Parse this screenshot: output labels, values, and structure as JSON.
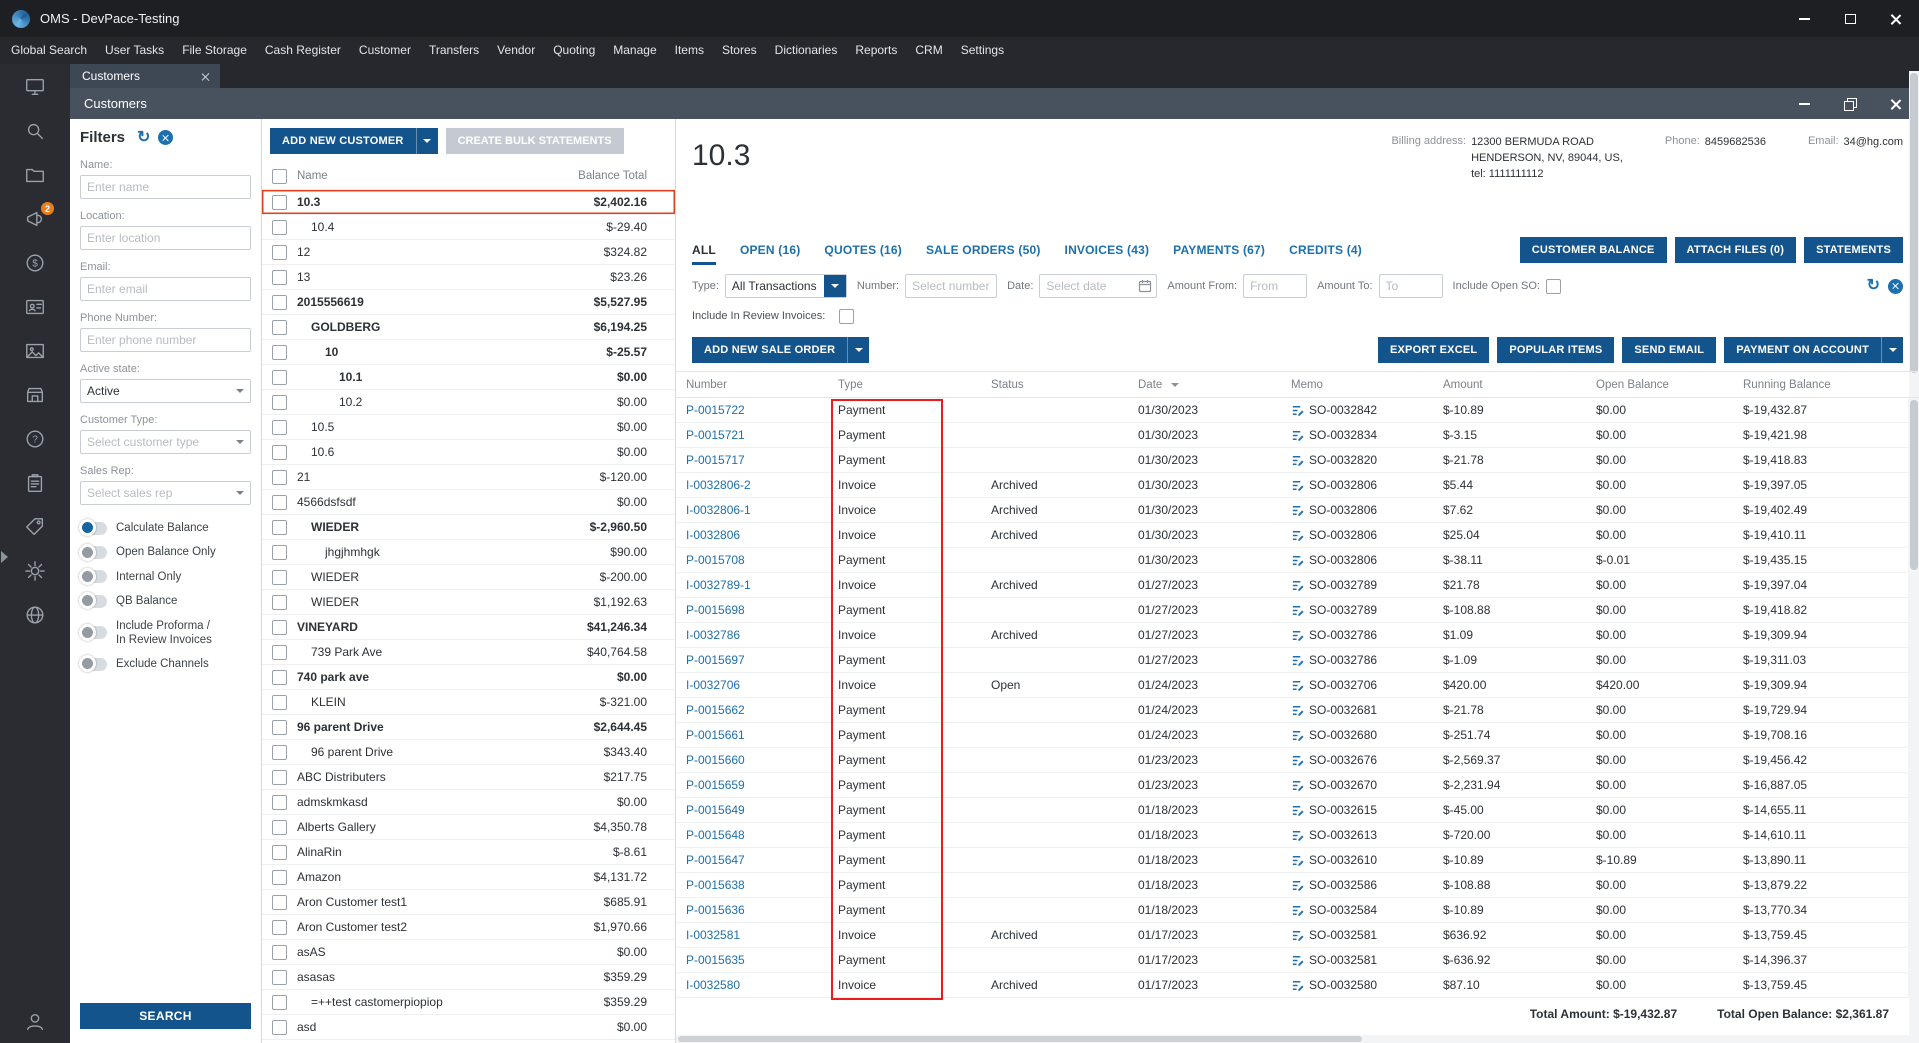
{
  "titlebar": {
    "title": "OMS - DevPace-Testing"
  },
  "menubar": {
    "items": [
      "Global Search",
      "User Tasks",
      "File Storage",
      "Cash Register",
      "Customer",
      "Transfers",
      "Vendor",
      "Quoting",
      "Manage",
      "Items",
      "Stores",
      "Dictionaries",
      "Reports",
      "CRM",
      "Settings"
    ]
  },
  "doc_tab": {
    "label": "Customers"
  },
  "inner_window": {
    "title": "Customers"
  },
  "icons": {
    "refresh": "↻"
  },
  "colors": {
    "accent_blue": "#14548c",
    "link_blue": "#1d6fad",
    "annotation_red": "#ec1c1c",
    "selected_row_orange": "#e2411e",
    "badge_orange": "#e87f1e"
  },
  "sidebar": {
    "badge": "2",
    "icon_names": [
      "dashboard-icon",
      "search-icon",
      "folder-icon",
      "announcements-icon",
      "payments-icon",
      "contacts-icon",
      "media-icon",
      "store-icon",
      "help-icon",
      "clipboard-icon",
      "tag-icon",
      "gear-icon",
      "globe-icon",
      "user-icon"
    ]
  },
  "filters": {
    "title": "Filters",
    "name_label": "Name:",
    "name_placeholder": "Enter name",
    "location_label": "Location:",
    "location_placeholder": "Enter location",
    "email_label": "Email:",
    "email_placeholder": "Enter email",
    "phone_label": "Phone Number:",
    "phone_placeholder": "Enter phone number",
    "active_state_label": "Active state:",
    "active_state_value": "Active",
    "customer_type_label": "Customer Type:",
    "customer_type_placeholder": "Select customer type",
    "sales_rep_label": "Sales Rep:",
    "sales_rep_placeholder": "Select sales rep",
    "toggles": [
      {
        "label": "Calculate Balance",
        "cls": "on"
      },
      {
        "label": "Open Balance Only",
        "cls": ""
      },
      {
        "label": "Internal Only",
        "cls": ""
      },
      {
        "label": "QB Balance",
        "cls": ""
      },
      {
        "label": "Include Proforma /\nIn Review Invoices",
        "cls": ""
      },
      {
        "label": "Exclude Channels",
        "cls": ""
      }
    ],
    "search_button": "SEARCH"
  },
  "customer_list": {
    "add_button": "ADD NEW CUSTOMER",
    "bulk_button": "CREATE BULK STATEMENTS",
    "columns": {
      "name": "Name",
      "balance": "Balance Total"
    },
    "rows": [
      {
        "name": "10.3",
        "balance": "$2,402.16",
        "cls": "bold selected"
      },
      {
        "name": "10.4",
        "balance": "$-29.40",
        "cls": "i1"
      },
      {
        "name": "12",
        "balance": "$324.82",
        "cls": ""
      },
      {
        "name": "13",
        "balance": "$23.26",
        "cls": ""
      },
      {
        "name": "2015556619",
        "balance": "$5,527.95",
        "cls": "bold"
      },
      {
        "name": "GOLDBERG",
        "balance": "$6,194.25",
        "cls": "bold i1"
      },
      {
        "name": "10",
        "balance": "$-25.57",
        "cls": "bold i2"
      },
      {
        "name": "10.1",
        "balance": "$0.00",
        "cls": "bold i3"
      },
      {
        "name": "10.2",
        "balance": "$0.00",
        "cls": "i3"
      },
      {
        "name": "10.5",
        "balance": "$0.00",
        "cls": "i1"
      },
      {
        "name": "10.6",
        "balance": "$0.00",
        "cls": "i1"
      },
      {
        "name": "21",
        "balance": "$-120.00",
        "cls": ""
      },
      {
        "name": "4566dsfsdf",
        "balance": "$0.00",
        "cls": ""
      },
      {
        "name": "WIEDER",
        "balance": "$-2,960.50",
        "cls": "bold i1"
      },
      {
        "name": "jhgjhmhgk",
        "balance": "$90.00",
        "cls": "i2"
      },
      {
        "name": "WIEDER",
        "balance": "$-200.00",
        "cls": "i1"
      },
      {
        "name": "WIEDER",
        "balance": "$1,192.63",
        "cls": "i1"
      },
      {
        "name": "VINEYARD",
        "balance": "$41,246.34",
        "cls": "bold"
      },
      {
        "name": "739 Park Ave",
        "balance": "$40,764.58",
        "cls": "i1"
      },
      {
        "name": "740 park ave",
        "balance": "$0.00",
        "cls": "bold"
      },
      {
        "name": "KLEIN",
        "balance": "$-321.00",
        "cls": "i1"
      },
      {
        "name": "96 parent Drive",
        "balance": "$2,644.45",
        "cls": "bold"
      },
      {
        "name": "96 parent Drive",
        "balance": "$343.40",
        "cls": "i1"
      },
      {
        "name": "ABC Distributers",
        "balance": "$217.75",
        "cls": ""
      },
      {
        "name": "admskmkasd",
        "balance": "$0.00",
        "cls": ""
      },
      {
        "name": "Alberts Gallery",
        "balance": "$4,350.78",
        "cls": ""
      },
      {
        "name": "AlinaRin",
        "balance": "$-8.61",
        "cls": ""
      },
      {
        "name": "Amazon",
        "balance": "$4,131.72",
        "cls": ""
      },
      {
        "name": "Aron Customer test1",
        "balance": "$685.91",
        "cls": ""
      },
      {
        "name": "Aron Customer test2",
        "balance": "$1,970.66",
        "cls": ""
      },
      {
        "name": "asAS",
        "balance": "$0.00",
        "cls": ""
      },
      {
        "name": "asasas",
        "balance": "$359.29",
        "cls": ""
      },
      {
        "name": "=++test castomerpiopiop",
        "balance": "$359.29",
        "cls": "i1"
      },
      {
        "name": "asd",
        "balance": "$0.00",
        "cls": ""
      }
    ]
  },
  "detail": {
    "customer_name": "10.3",
    "billing": {
      "address_label": "Billing address:",
      "address": "12300 BERMUDA ROAD\nHENDERSON, NV, 89044, US,\ntel: 1111111112",
      "phone_label": "Phone:",
      "phone": "8459682536",
      "email_label": "Email:",
      "email": "34@hg.com"
    },
    "tabs": [
      {
        "label": "ALL",
        "cls": "active"
      },
      {
        "label": "OPEN (16)",
        "cls": ""
      },
      {
        "label": "QUOTES (16)",
        "cls": ""
      },
      {
        "label": "SALE ORDERS (50)",
        "cls": ""
      },
      {
        "label": "INVOICES (43)",
        "cls": ""
      },
      {
        "label": "PAYMENTS (67)",
        "cls": ""
      },
      {
        "label": "CREDITS (4)",
        "cls": ""
      }
    ],
    "header_buttons": {
      "customer_balance": "CUSTOMER BALANCE",
      "attach_files": "ATTACH FILES (0)",
      "statements": "STATEMENTS"
    },
    "filter_bar": {
      "type_label": "Type:",
      "type_value": "All Transactions",
      "number_label": "Number:",
      "number_placeholder": "Select number",
      "date_label": "Date:",
      "date_placeholder": "Select date",
      "amount_from_label": "Amount From:",
      "amount_from_placeholder": "From",
      "amount_to_label": "Amount To:",
      "amount_to_placeholder": "To",
      "include_open_so_label": "Include Open SO:",
      "include_review_label": "Include In Review Invoices:"
    },
    "toolbar": {
      "add_sale_order": "ADD NEW SALE ORDER",
      "export_excel": "EXPORT EXCEL",
      "popular_items": "POPULAR ITEMS",
      "send_email": "SEND EMAIL",
      "payment_on_account": "PAYMENT ON ACCOUNT"
    },
    "grid": {
      "columns": [
        "Number",
        "Type",
        "Status",
        "Date",
        "Memo",
        "Amount",
        "Open Balance",
        "Running Balance"
      ],
      "rows": [
        {
          "number": "P-0015722",
          "type": "Payment",
          "status": "",
          "date": "01/30/2023",
          "memo": "SO-0032842",
          "amount": "$-10.89",
          "open": "$0.00",
          "running": "$-19,432.87"
        },
        {
          "number": "P-0015721",
          "type": "Payment",
          "status": "",
          "date": "01/30/2023",
          "memo": "SO-0032834",
          "amount": "$-3.15",
          "open": "$0.00",
          "running": "$-19,421.98"
        },
        {
          "number": "P-0015717",
          "type": "Payment",
          "status": "",
          "date": "01/30/2023",
          "memo": "SO-0032820",
          "amount": "$-21.78",
          "open": "$0.00",
          "running": "$-19,418.83"
        },
        {
          "number": "I-0032806-2",
          "type": "Invoice",
          "status": "Archived",
          "date": "01/30/2023",
          "memo": "SO-0032806",
          "amount": "$5.44",
          "open": "$0.00",
          "running": "$-19,397.05"
        },
        {
          "number": "I-0032806-1",
          "type": "Invoice",
          "status": "Archived",
          "date": "01/30/2023",
          "memo": "SO-0032806",
          "amount": "$7.62",
          "open": "$0.00",
          "running": "$-19,402.49"
        },
        {
          "number": "I-0032806",
          "type": "Invoice",
          "status": "Archived",
          "date": "01/30/2023",
          "memo": "SO-0032806",
          "amount": "$25.04",
          "open": "$0.00",
          "running": "$-19,410.11"
        },
        {
          "number": "P-0015708",
          "type": "Payment",
          "status": "",
          "date": "01/30/2023",
          "memo": "SO-0032806",
          "amount": "$-38.11",
          "open": "$-0.01",
          "running": "$-19,435.15"
        },
        {
          "number": "I-0032789-1",
          "type": "Invoice",
          "status": "Archived",
          "date": "01/27/2023",
          "memo": "SO-0032789",
          "amount": "$21.78",
          "open": "$0.00",
          "running": "$-19,397.04"
        },
        {
          "number": "P-0015698",
          "type": "Payment",
          "status": "",
          "date": "01/27/2023",
          "memo": "SO-0032789",
          "amount": "$-108.88",
          "open": "$0.00",
          "running": "$-19,418.82"
        },
        {
          "number": "I-0032786",
          "type": "Invoice",
          "status": "Archived",
          "date": "01/27/2023",
          "memo": "SO-0032786",
          "amount": "$1.09",
          "open": "$0.00",
          "running": "$-19,309.94"
        },
        {
          "number": "P-0015697",
          "type": "Payment",
          "status": "",
          "date": "01/27/2023",
          "memo": "SO-0032786",
          "amount": "$-1.09",
          "open": "$0.00",
          "running": "$-19,311.03"
        },
        {
          "number": "I-0032706",
          "type": "Invoice",
          "status": "Open",
          "date": "01/24/2023",
          "memo": "SO-0032706",
          "amount": "$420.00",
          "open": "$420.00",
          "running": "$-19,309.94"
        },
        {
          "number": "P-0015662",
          "type": "Payment",
          "status": "",
          "date": "01/24/2023",
          "memo": "SO-0032681",
          "amount": "$-21.78",
          "open": "$0.00",
          "running": "$-19,729.94"
        },
        {
          "number": "P-0015661",
          "type": "Payment",
          "status": "",
          "date": "01/24/2023",
          "memo": "SO-0032680",
          "amount": "$-251.74",
          "open": "$0.00",
          "running": "$-19,708.16"
        },
        {
          "number": "P-0015660",
          "type": "Payment",
          "status": "",
          "date": "01/23/2023",
          "memo": "SO-0032676",
          "amount": "$-2,569.37",
          "open": "$0.00",
          "running": "$-19,456.42"
        },
        {
          "number": "P-0015659",
          "type": "Payment",
          "status": "",
          "date": "01/23/2023",
          "memo": "SO-0032670",
          "amount": "$-2,231.94",
          "open": "$0.00",
          "running": "$-16,887.05"
        },
        {
          "number": "P-0015649",
          "type": "Payment",
          "status": "",
          "date": "01/18/2023",
          "memo": "SO-0032615",
          "amount": "$-45.00",
          "open": "$0.00",
          "running": "$-14,655.11"
        },
        {
          "number": "P-0015648",
          "type": "Payment",
          "status": "",
          "date": "01/18/2023",
          "memo": "SO-0032613",
          "amount": "$-720.00",
          "open": "$0.00",
          "running": "$-14,610.11"
        },
        {
          "number": "P-0015647",
          "type": "Payment",
          "status": "",
          "date": "01/18/2023",
          "memo": "SO-0032610",
          "amount": "$-10.89",
          "open": "$-10.89",
          "running": "$-13,890.11"
        },
        {
          "number": "P-0015638",
          "type": "Payment",
          "status": "",
          "date": "01/18/2023",
          "memo": "SO-0032586",
          "amount": "$-108.88",
          "open": "$0.00",
          "running": "$-13,879.22"
        },
        {
          "number": "P-0015636",
          "type": "Payment",
          "status": "",
          "date": "01/18/2023",
          "memo": "SO-0032584",
          "amount": "$-10.89",
          "open": "$0.00",
          "running": "$-13,770.34"
        },
        {
          "number": "I-0032581",
          "type": "Invoice",
          "status": "Archived",
          "date": "01/17/2023",
          "memo": "SO-0032581",
          "amount": "$636.92",
          "open": "$0.00",
          "running": "$-13,759.45"
        },
        {
          "number": "P-0015635",
          "type": "Payment",
          "status": "",
          "date": "01/17/2023",
          "memo": "SO-0032581",
          "amount": "$-636.92",
          "open": "$0.00",
          "running": "$-14,396.37"
        },
        {
          "number": "I-0032580",
          "type": "Invoice",
          "status": "Archived",
          "date": "01/17/2023",
          "memo": "SO-0032580",
          "amount": "$87.10",
          "open": "$0.00",
          "running": "$-13,759.45"
        }
      ]
    },
    "totals": {
      "amount_label": "Total Amount:",
      "amount": "$-19,432.87",
      "open_label": "Total Open Balance:",
      "open": "$2,361.87"
    }
  }
}
